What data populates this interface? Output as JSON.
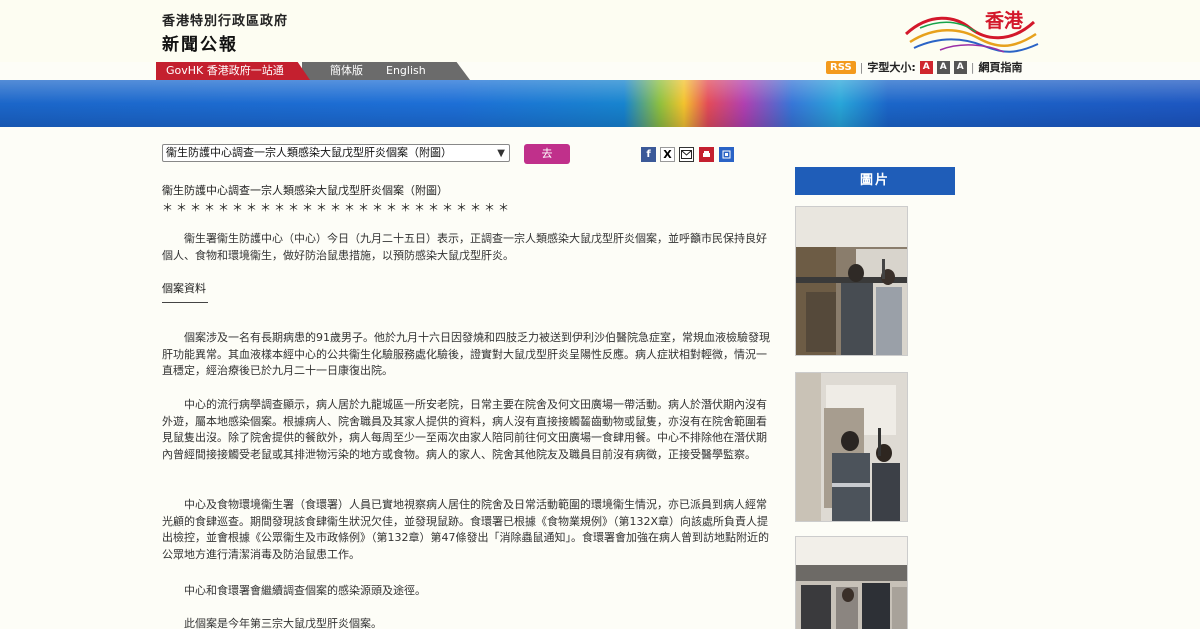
{
  "header": {
    "gov_name": "香港特別行政區政府",
    "site_name": "新聞公報",
    "logo_text": "香港"
  },
  "nav": {
    "govhk_label": "GovHK 香港政府一站通",
    "lang_simplified": "簡体版",
    "lang_english": "English"
  },
  "tools": {
    "rss": "RSS",
    "font_size_label": "字型大小:",
    "font_sizes": [
      "A",
      "A",
      "A"
    ],
    "site_guide": "網頁指南"
  },
  "toolbar": {
    "select_value": "衞生防護中心調查一宗人類感染大鼠戊型肝炎個案（附圖）",
    "go_label": "去"
  },
  "article": {
    "title": "衞生防護中心調查一宗人類感染大鼠戊型肝炎個案（附圖）",
    "stars": "＊＊＊＊＊＊＊＊＊＊＊＊＊＊＊＊＊＊＊＊＊＊＊＊＊",
    "intro": "衞生署衞生防護中心（中心）今日（九月二十五日）表示，正調查一宗人類感染大鼠戊型肝炎個案，並呼籲市民保持良好個人、食物和環境衞生，做好防治鼠患措施，以預防感染大鼠戊型肝炎。",
    "subhead": "個案資料",
    "p1": "個案涉及一名有長期病患的91歲男子。他於九月十六日因發燒和四肢乏力被送到伊利沙伯醫院急症室，常規血液檢驗發現肝功能異常。其血液樣本經中心的公共衞生化驗服務處化驗後，證實對大鼠戊型肝炎呈陽性反應。病人症狀相對輕微，情況一直穩定，經治療後已於九月二十一日康復出院。",
    "p2": "中心的流行病學調查顯示，病人居於九龍城區一所安老院，日常主要在院舍及何文田廣場一帶活動。病人於潛伏期內沒有外遊，屬本地感染個案。根據病人、院舍職員及其家人提供的資料，病人沒有直接接觸齧齒動物或鼠隻，亦沒有在院舍範圍看見鼠隻出沒。除了院舍提供的餐飲外，病人每周至少一至兩次由家人陪同前往何文田廣場一食肆用餐。中心不排除他在潛伏期內曾經間接接觸受老鼠或其排泄物污染的地方或食物。病人的家人、院舍其他院友及職員目前沒有病徵，正接受醫學監察。",
    "p3": "中心及食物環境衞生署（食環署）人員已實地視察病人居住的院舍及日常活動範圍的環境衞生情況，亦已派員到病人經常光顧的食肆巡查。期間發現該食肆衞生狀況欠佳，並發現鼠跡。食環署已根據《食物業規例》（第132X章）向該處所負責人提出檢控，並會根據《公眾衞生及市政條例》（第132章）第47條發出「消除蟲鼠通知」。食環署會加強在病人曾到訪地點附近的公眾地方進行清潔消毒及防治鼠患工作。",
    "p4": "中心和食環署會繼續調查個案的感染源頭及途徑。",
    "p5": "此個案是今年第三宗大鼠戊型肝炎個案。"
  },
  "sidebar": {
    "photo_heading": "圖片"
  },
  "colors": {
    "brand_red": "#c4202f",
    "banner_blue": "#1b66c9",
    "go_button": "#c0308b",
    "photo_heading": "#1f5db8"
  }
}
